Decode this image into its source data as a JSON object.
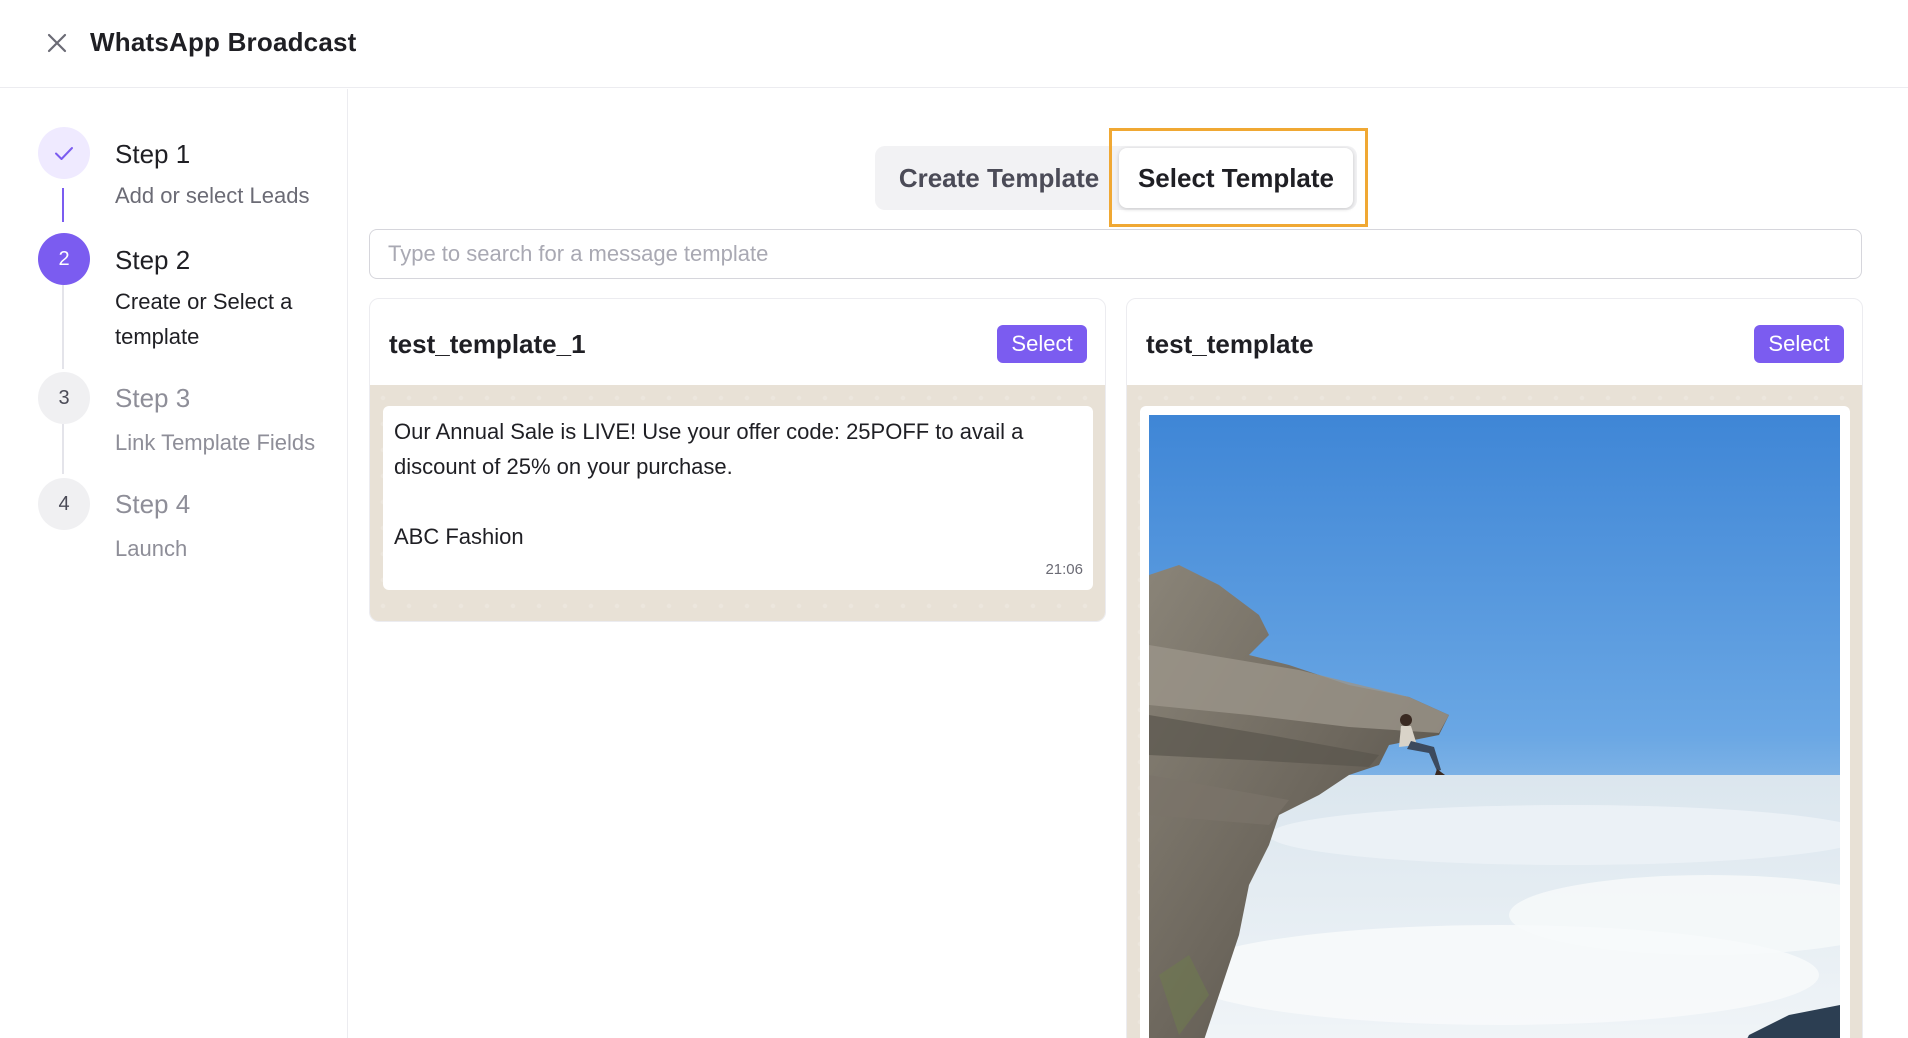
{
  "header": {
    "title": "WhatsApp Broadcast",
    "close_icon": "close-icon"
  },
  "steps": [
    {
      "title": "Step 1",
      "desc": "Add or select Leads",
      "status": "completed",
      "marker_icon": "check-icon"
    },
    {
      "title": "Step 2",
      "desc": "Create or Select a template",
      "status": "active",
      "marker": "2"
    },
    {
      "title": "Step 3",
      "desc": "Link Template Fields",
      "status": "upcoming",
      "marker": "3"
    },
    {
      "title": "Step 4",
      "desc": "Launch",
      "status": "upcoming",
      "marker": "4"
    }
  ],
  "template_tabs": {
    "create_label": "Create Template",
    "select_label": "Select Template",
    "active": "Select Template"
  },
  "search": {
    "placeholder": "Type to search for a message template",
    "value": ""
  },
  "templates": [
    {
      "name": "test_template_1",
      "select_label": "Select",
      "message": "Our Annual Sale is LIVE! Use your offer code: 25POFF to avail a discount of 25% on your purchase.\n\nABC Fashion",
      "time": "21:06"
    },
    {
      "name": "test_template",
      "select_label": "Select",
      "media": "photo of a person sitting on a cliff edge above clouds"
    }
  ],
  "colors": {
    "accent": "#7b5cf0",
    "highlight": "#f0a833",
    "chat_background": "#e8e1d6",
    "step_done_bg": "#efeaff",
    "step_upcoming_bg": "#f0f0f2"
  }
}
